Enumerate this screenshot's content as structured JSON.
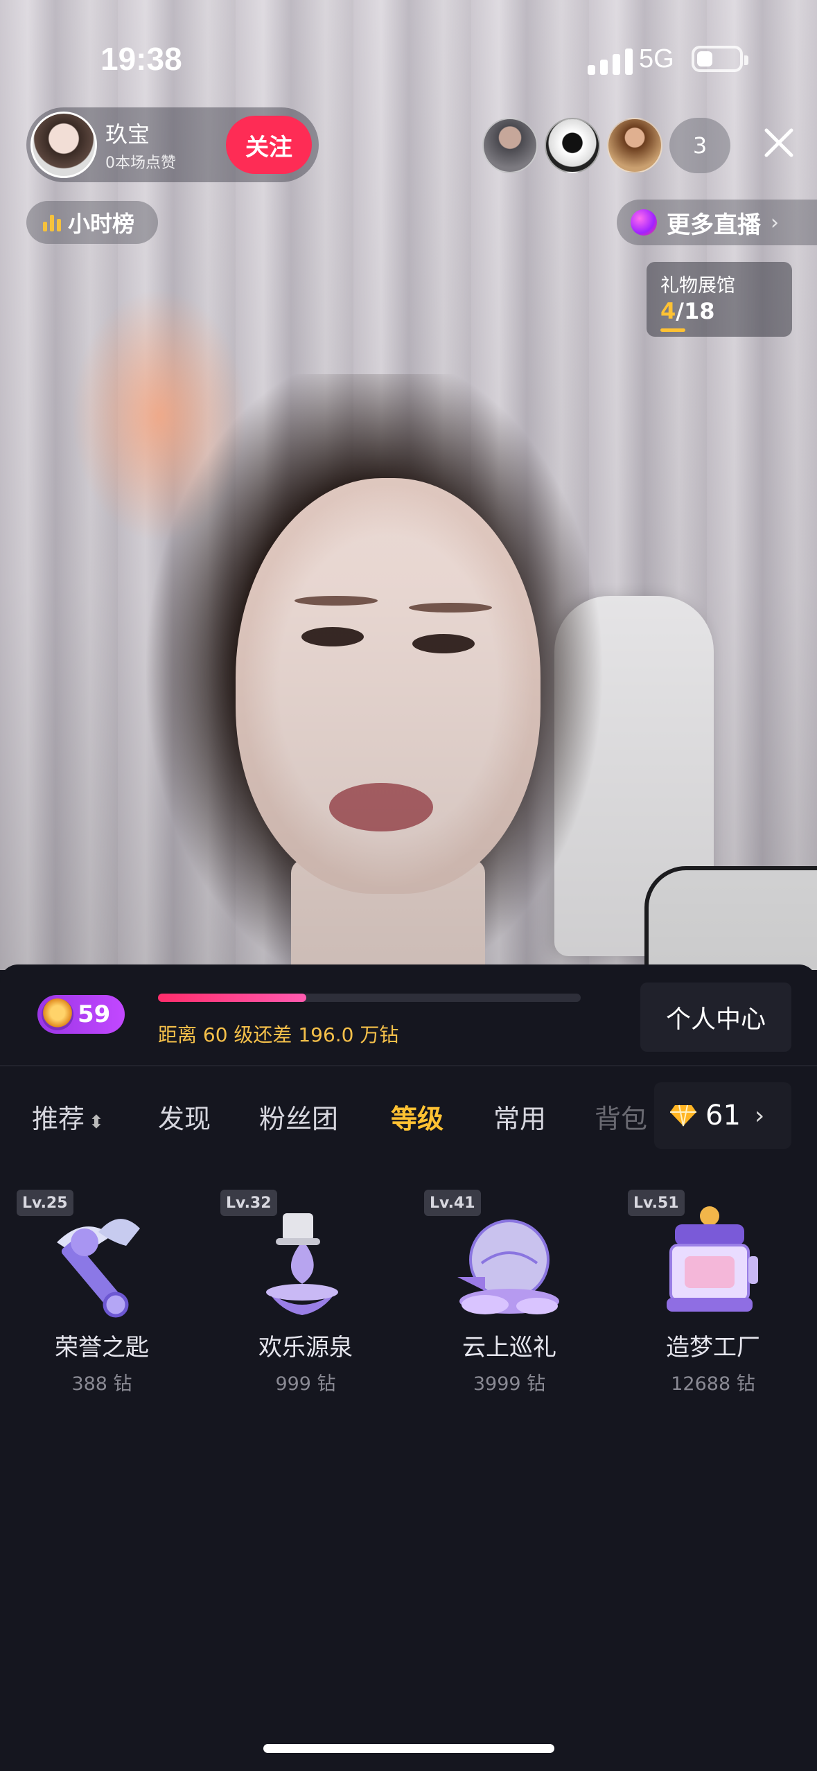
{
  "status_bar": {
    "time": "19:38",
    "network": "5G",
    "battery_level": 0.25
  },
  "host": {
    "name": "玖宝",
    "likes_text": "0本场点赞",
    "follow_label": "关注"
  },
  "viewers": {
    "count": "3",
    "avatars": [
      "viewer-avatar-1",
      "viewer-avatar-2",
      "viewer-avatar-3"
    ]
  },
  "rank_button": {
    "label": "小时榜"
  },
  "more_live": {
    "label": "更多直播",
    "chevron": "›"
  },
  "gift_gallery": {
    "title": "礼物展馆",
    "current": "4",
    "total": "/18",
    "progress": 0.22
  },
  "level_panel": {
    "level": "59",
    "progress_fraction": 0.35,
    "progress_text": "距离 60 级还差 196.0 万钻",
    "center_label": "个人中心"
  },
  "tabs": [
    {
      "label": "推荐",
      "sort_icon": "⬍",
      "active": false
    },
    {
      "label": "发现",
      "active": false
    },
    {
      "label": "粉丝团",
      "active": false
    },
    {
      "label": "等级",
      "active": true
    },
    {
      "label": "常用",
      "active": false
    },
    {
      "label": "背包",
      "active": false
    }
  ],
  "balance": {
    "amount": "61",
    "chevron": "›",
    "icon": "diamond-icon"
  },
  "gifts": [
    {
      "level": "Lv.25",
      "name": "荣誉之匙",
      "price": "388 钻"
    },
    {
      "level": "Lv.32",
      "name": "欢乐源泉",
      "price": "999 钻"
    },
    {
      "level": "Lv.41",
      "name": "云上巡礼",
      "price": "3999 钻"
    },
    {
      "level": "Lv.51",
      "name": "造梦工厂",
      "price": "12688 钻"
    }
  ],
  "colors": {
    "accent_pink": "#fe2c55",
    "accent_gold": "#ffc233",
    "panel_bg": "#15161f"
  }
}
